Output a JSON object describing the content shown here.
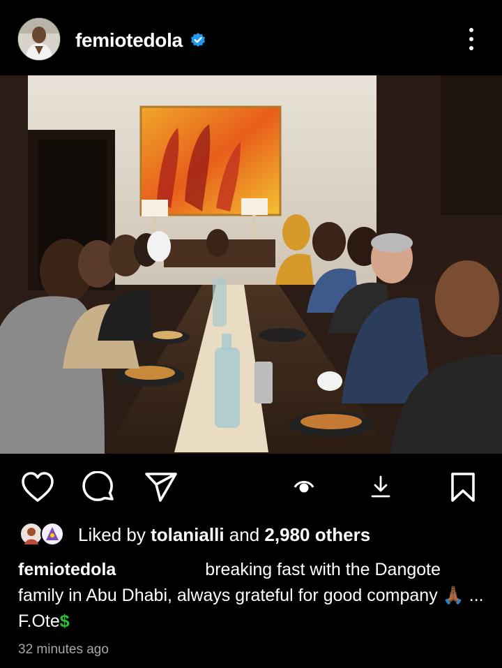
{
  "post": {
    "username": "femiotedola",
    "verified_icon": "verified-badge-icon",
    "more_icon": "more-vertical-icon"
  },
  "photo": {
    "icon": "dinner-photo"
  },
  "actions": {
    "like_icon": "heart-icon",
    "comment_icon": "comment-icon",
    "share_icon": "send-icon",
    "view_icon": "eye-icon",
    "download_icon": "download-icon",
    "save_icon": "bookmark-icon"
  },
  "likes": {
    "prefix": "Liked by",
    "liker": "tolanialli",
    "joiner": "and",
    "others": "2,980 others"
  },
  "caption": {
    "username": "femiotedola",
    "text_before_emoji": "breaking fast with the Dangote family in Abu Dhabi, always grateful for good company",
    "emoji": "🙏🏾",
    "text_after_emoji": "... F.Ote",
    "dollar": "$"
  },
  "timestamp": "32 minutes ago",
  "colors": {
    "background": "#000000",
    "verified": "#1d9bf0",
    "secondary_text": "#a8a8a8",
    "dollar": "#26c234"
  }
}
